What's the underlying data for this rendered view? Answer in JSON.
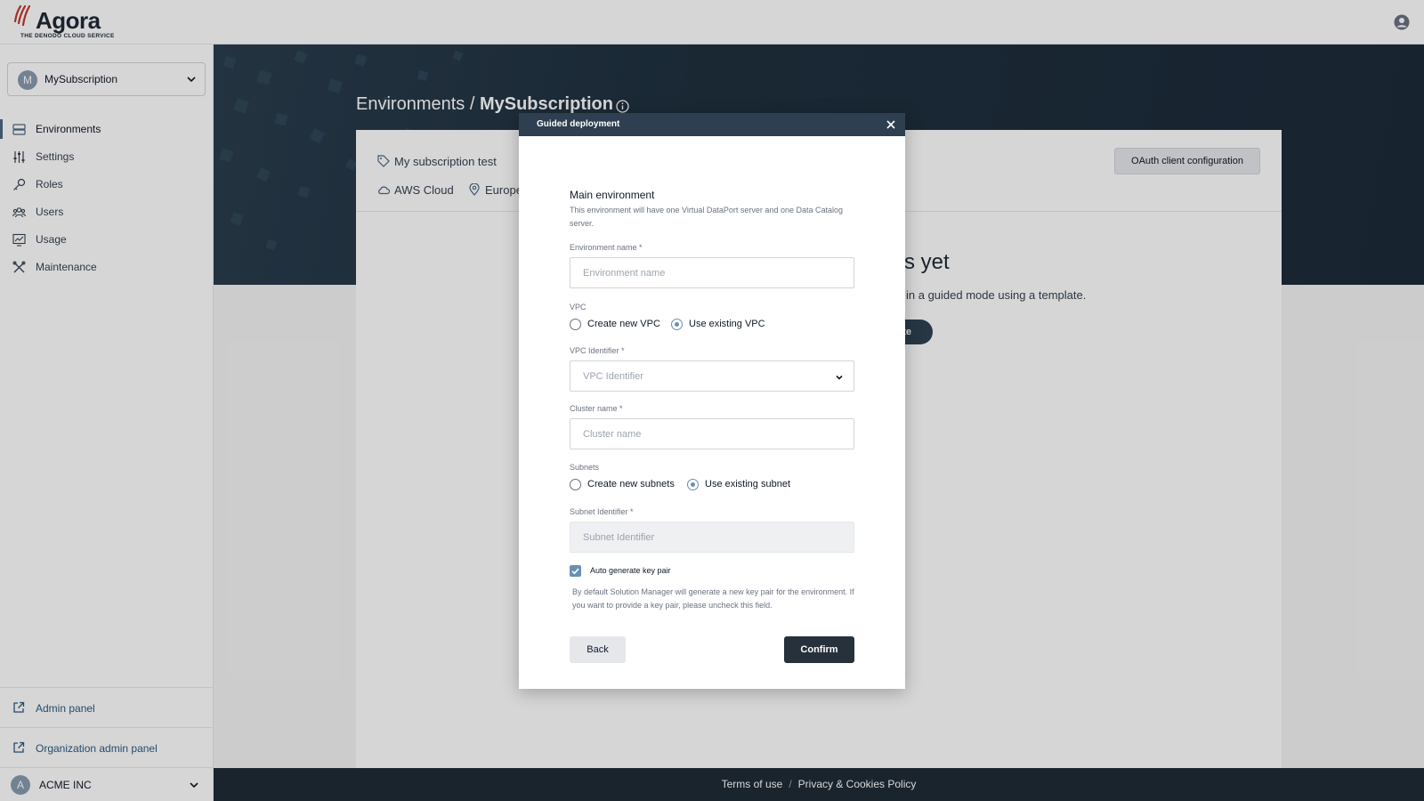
{
  "brand": {
    "name": "Agora",
    "tagline": "THE DENODO CLOUD SERVICE",
    "accent": "#c0392b"
  },
  "header": {
    "user_icon": "user-circle-icon"
  },
  "sidebar": {
    "subscription": {
      "initial": "M",
      "name": "MySubscription"
    },
    "items": [
      {
        "label": "Environments",
        "icon": "server-icon",
        "active": true
      },
      {
        "label": "Settings",
        "icon": "sliders-icon"
      },
      {
        "label": "Roles",
        "icon": "key-icon"
      },
      {
        "label": "Users",
        "icon": "users-icon"
      },
      {
        "label": "Usage",
        "icon": "chart-icon"
      },
      {
        "label": "Maintenance",
        "icon": "tools-icon"
      }
    ],
    "admin_panel": "Admin panel",
    "org_admin_panel": "Organization admin panel",
    "org": {
      "initial": "A",
      "name": "ACME INC"
    }
  },
  "main": {
    "breadcrumb_root": "Environments",
    "breadcrumb_sep": "/",
    "breadcrumb_current": "MySubscription",
    "subscription_desc": "My subscription test",
    "cloud": "AWS Cloud",
    "region": "Europe",
    "oauth_button": "OAuth client configuration",
    "empty_title": "nts yet",
    "empty_sub": "in a guided mode using a template.",
    "empty_button": "te"
  },
  "modal": {
    "title": "Guided deployment",
    "section_title": "Main environment",
    "section_desc": "This environment will have one Virtual DataPort server and one Data Catalog server.",
    "env_name_label": "Environment name *",
    "env_name_placeholder": "Environment name",
    "vpc_label": "VPC",
    "vpc_option_new": "Create new VPC",
    "vpc_option_existing": "Use existing VPC",
    "vpc_id_label": "VPC Identifier *",
    "vpc_id_placeholder": "VPC Identifier",
    "cluster_label": "Cluster name *",
    "cluster_placeholder": "Cluster name",
    "subnets_label": "Subnets",
    "subnet_option_new": "Create new subnets",
    "subnet_option_existing": "Use existing subnet",
    "subnet_id_label": "Subnet Identifier *",
    "subnet_id_placeholder": "Subnet Identifier",
    "keypair_label": "Auto generate key pair",
    "keypair_help": "By default Solution Manager will generate a new key pair for the environment. If you want to provide a key pair, please uncheck this field.",
    "back": "Back",
    "confirm": "Confirm"
  },
  "footer": {
    "terms": "Terms of use",
    "sep": "/",
    "privacy": "Privacy & Cookies Policy"
  }
}
